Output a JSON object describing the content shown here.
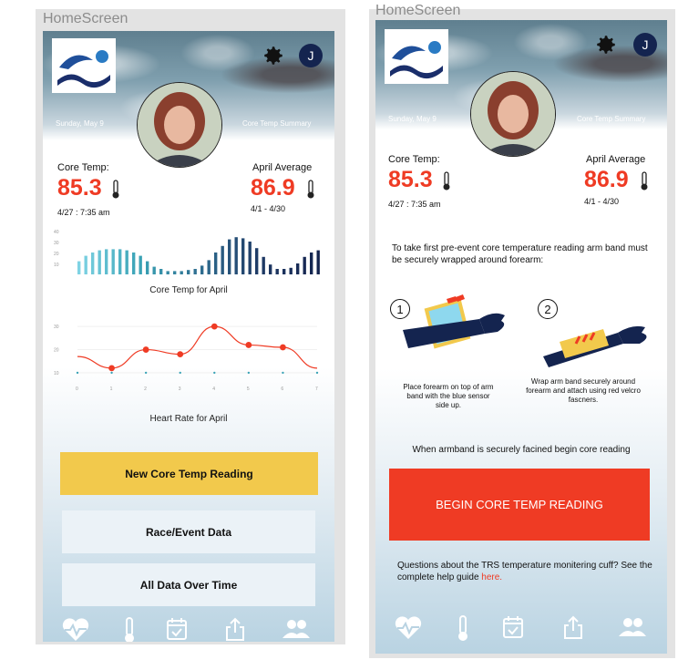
{
  "screens": [
    {
      "frame_label": "HomeScreen",
      "date": "Sunday, May 9",
      "summary": "Core Temp Summary",
      "avatar_initial": "J",
      "core_temp": {
        "label": "Core Temp:",
        "value": "85.3",
        "timestamp": "4/27 : 7:35 am"
      },
      "april_average": {
        "label": "April Average",
        "value": "86.9",
        "range": "4/1 - 4/30"
      },
      "bar_chart": {
        "title": "Core Temp for April",
        "y_ticks": [
          "40",
          "30",
          "20",
          "10"
        ]
      },
      "line_chart": {
        "title": "Heart Rate for April",
        "y_ticks": [
          "30",
          "20",
          "10"
        ],
        "x_ticks": [
          "0",
          "1",
          "2",
          "3",
          "4",
          "5",
          "6",
          "7"
        ]
      },
      "buttons": {
        "new_reading": "New Core Temp Reading",
        "race_data": "Race/Event Data",
        "all_data": "All Data Over Time"
      },
      "tabs": [
        "heart-icon",
        "thermometer-icon",
        "calendar-icon",
        "share-icon",
        "people-icon"
      ]
    },
    {
      "frame_label": "HomeScreen",
      "date": "Sunday, May 9",
      "summary": "Core Temp Summary",
      "avatar_initial": "J",
      "core_temp": {
        "label": "Core Temp:",
        "value": "85.3",
        "timestamp": "4/27 : 7:35 am"
      },
      "april_average": {
        "label": "April Average",
        "value": "86.9",
        "range": "4/1 - 4/30"
      },
      "instructions": "To take first pre-event core temperature reading arm band must be securely wrapped around forearm:",
      "steps": [
        {
          "num": "1",
          "caption": "Place forearm on top of arm band with the blue sensor side up."
        },
        {
          "num": "2",
          "caption": "Wrap arm band securely around forearm and attach using red velcro fascners."
        }
      ],
      "ready_text": "When armband is securely facined begin core reading",
      "begin_button": "BEGIN CORE TEMP READING",
      "help_text": "Questions about the TRS temperature monitering cuff? See the complete help guide ",
      "help_link": "here.",
      "tabs": [
        "heart-icon",
        "thermometer-icon",
        "calendar-icon",
        "share-icon",
        "people-icon"
      ]
    }
  ],
  "chart_data": [
    {
      "type": "bar",
      "title": "Core Temp for April",
      "y_ticks": [
        "40",
        "30",
        "20",
        "10"
      ],
      "ylim": [
        0,
        40
      ],
      "values": [
        12,
        17,
        20,
        22,
        23,
        23,
        23,
        22,
        20,
        17,
        12,
        7,
        5,
        3,
        3,
        3,
        4,
        5,
        8,
        13,
        20,
        26,
        32,
        34,
        33,
        30,
        24,
        16,
        9,
        5,
        5,
        6,
        10,
        16,
        20,
        22
      ],
      "colors": [
        "#7fd3e4",
        "#3aa3b6",
        "#2f6f91",
        "#1f3b66",
        "#14244f"
      ]
    },
    {
      "type": "line",
      "title": "Heart Rate for April",
      "x_ticks": [
        "0",
        "1",
        "2",
        "3",
        "4",
        "5",
        "6",
        "7"
      ],
      "y_ticks": [
        "30",
        "20",
        "10"
      ],
      "ylim": [
        8,
        34
      ],
      "xlim": [
        0,
        7
      ],
      "x": [
        0,
        1,
        2,
        3,
        4,
        5,
        6,
        7
      ],
      "y": [
        17,
        12,
        20,
        18,
        30,
        22,
        21,
        12
      ],
      "markers": [
        1,
        2,
        3,
        4,
        5,
        6
      ]
    }
  ]
}
